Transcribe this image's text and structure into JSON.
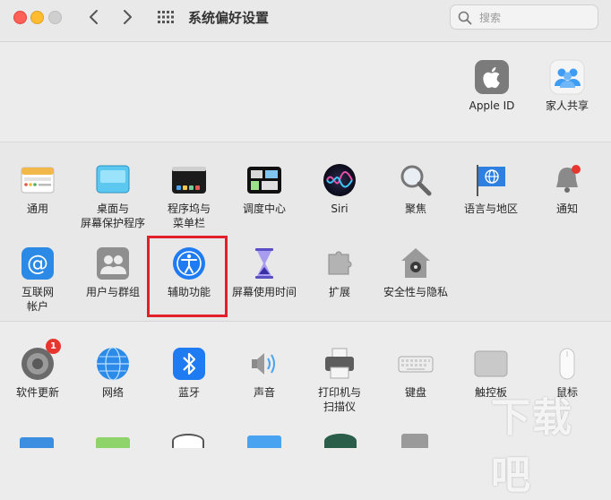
{
  "window": {
    "title": "系统偏好设置",
    "search_placeholder": "搜索"
  },
  "top_panes": [
    {
      "label": "Apple ID",
      "icon": "apple-id-icon"
    },
    {
      "label": "家人共享",
      "icon": "family-sharing-icon"
    }
  ],
  "row1": [
    {
      "label": "通用",
      "icon": "general-icon"
    },
    {
      "label": "桌面与",
      "label2": "屏幕保护程序",
      "icon": "desktop-screensaver-icon"
    },
    {
      "label": "程序坞与",
      "label2": "菜单栏",
      "icon": "dock-menubar-icon"
    },
    {
      "label": "调度中心",
      "icon": "mission-control-icon"
    },
    {
      "label": "Siri",
      "icon": "siri-icon"
    },
    {
      "label": "聚焦",
      "icon": "spotlight-icon"
    },
    {
      "label": "语言与地区",
      "icon": "language-region-icon"
    },
    {
      "label": "通知",
      "icon": "notifications-icon"
    }
  ],
  "row2": [
    {
      "label": "互联网",
      "label2": "帐户",
      "icon": "internet-accounts-icon"
    },
    {
      "label": "用户与群组",
      "icon": "users-groups-icon"
    },
    {
      "label": "辅助功能",
      "icon": "accessibility-icon"
    },
    {
      "label": "屏幕使用时间",
      "icon": "screen-time-icon"
    },
    {
      "label": "扩展",
      "icon": "extensions-icon"
    },
    {
      "label": "安全性与隐私",
      "icon": "security-privacy-icon"
    }
  ],
  "row3": [
    {
      "label": "软件更新",
      "icon": "software-update-icon",
      "badge": "1"
    },
    {
      "label": "网络",
      "icon": "network-icon"
    },
    {
      "label": "蓝牙",
      "icon": "bluetooth-icon"
    },
    {
      "label": "声音",
      "icon": "sound-icon"
    },
    {
      "label": "打印机与",
      "label2": "扫描仪",
      "icon": "printers-scanners-icon"
    },
    {
      "label": "键盘",
      "icon": "keyboard-icon"
    },
    {
      "label": "触控板",
      "icon": "trackpad-icon"
    },
    {
      "label": "鼠标",
      "icon": "mouse-icon"
    }
  ],
  "watermark": "下载吧",
  "colors": {
    "highlight": "#e0212a",
    "accent_blue": "#1f7bf2"
  }
}
